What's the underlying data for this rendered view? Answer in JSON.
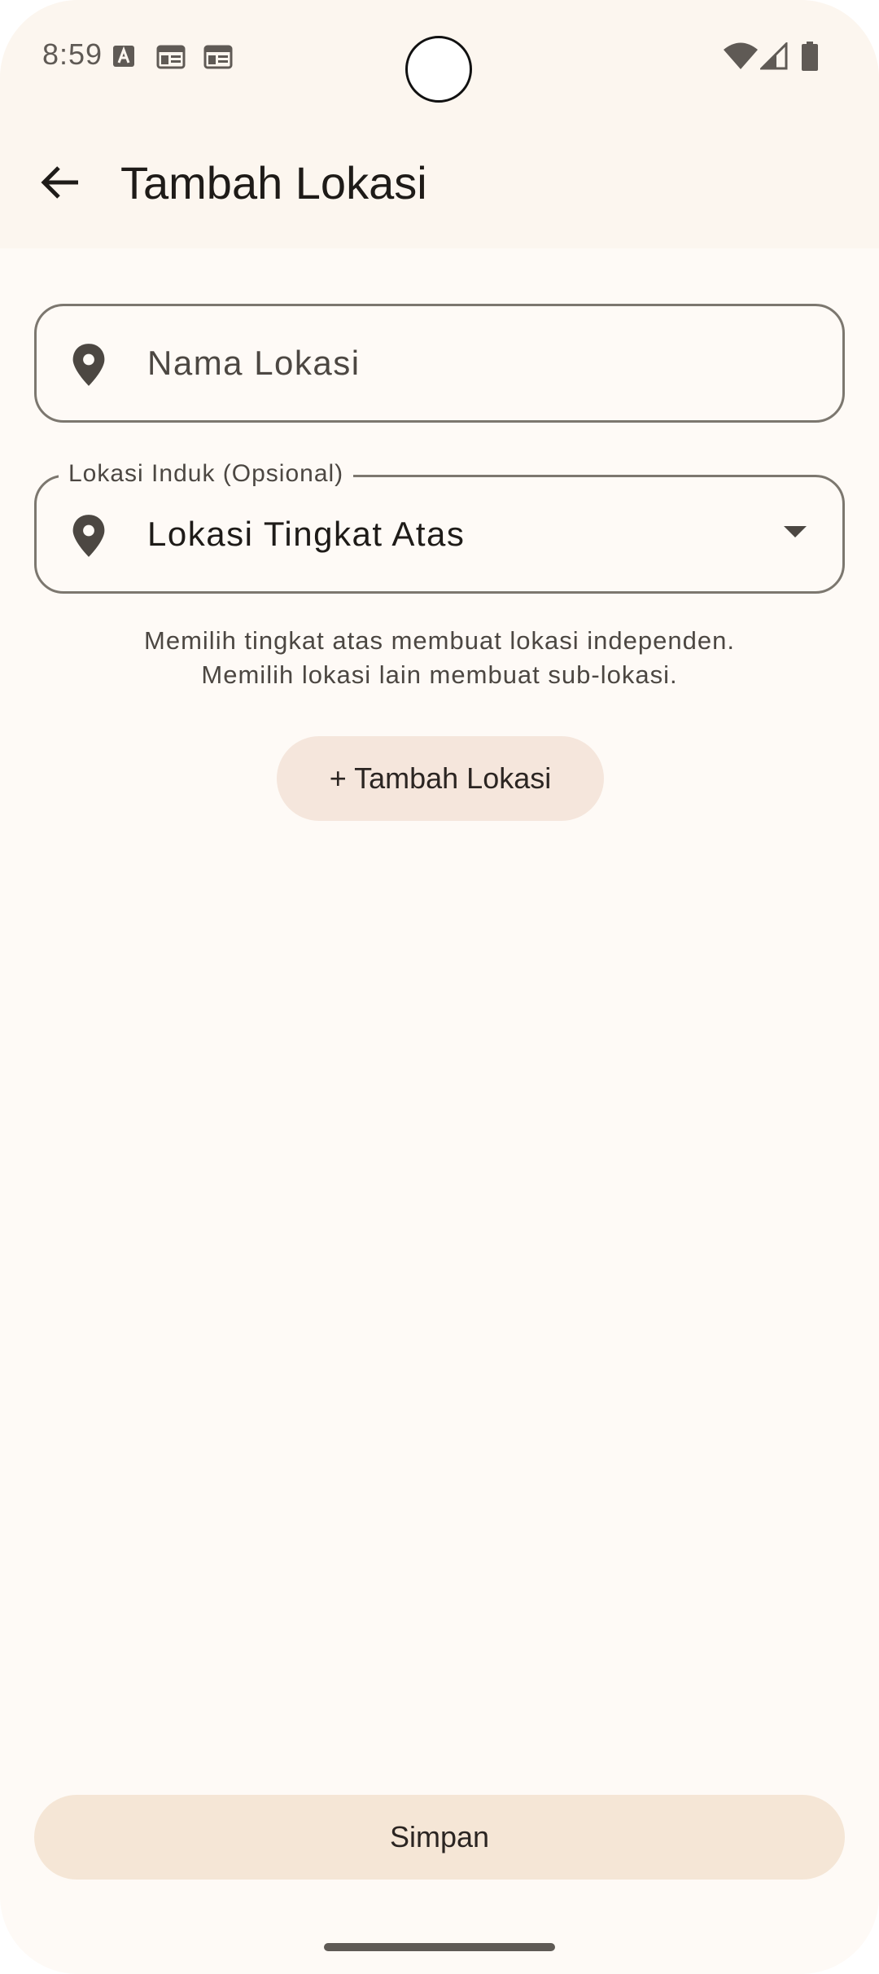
{
  "status_bar": {
    "time": "8:59",
    "icons": [
      "text-notification-icon",
      "calendar-icon",
      "calendar-icon",
      "wifi-icon",
      "signal-icon",
      "battery-icon"
    ]
  },
  "app_bar": {
    "title": "Tambah Lokasi",
    "back_icon": "arrow-left-icon"
  },
  "form": {
    "name_field": {
      "placeholder": "Nama Lokasi",
      "value": "",
      "icon": "location-pin-icon"
    },
    "parent_field": {
      "label": "Lokasi Induk (Opsional)",
      "value": "Lokasi Tingkat Atas",
      "icon": "location-pin-icon",
      "dropdown_icon": "dropdown-arrow-icon"
    },
    "helper_line1": "Memilih tingkat atas membuat lokasi independen.",
    "helper_line2": "Memilih lokasi lain membuat sub-lokasi.",
    "add_button_label": "+ Tambah Lokasi"
  },
  "footer": {
    "save_label": "Simpan"
  },
  "colors": {
    "background": "#fefaf6",
    "top_bar": "#fcf6ef",
    "outline": "#7c776f",
    "tonal_button": "#f5e6dc",
    "save_button": "#f5e6d6",
    "icon": "#4c4742"
  }
}
